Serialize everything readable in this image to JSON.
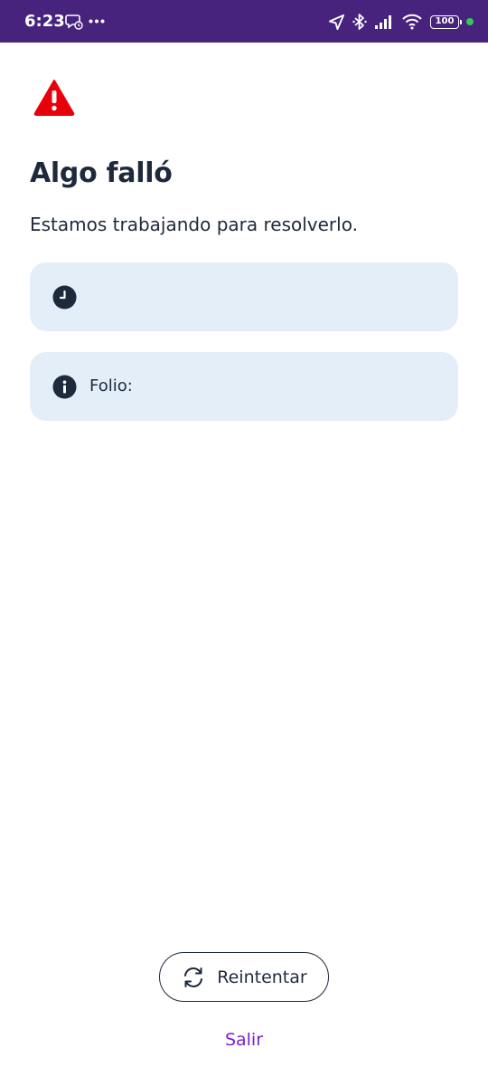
{
  "status_bar": {
    "time": "6:23",
    "battery": "100",
    "icons": [
      "chat-bubble-icon",
      "more-dots-icon",
      "navigation-arrow-icon",
      "bluetooth-icon",
      "signal-bars-icon",
      "wifi-icon",
      "battery-icon",
      "online-dot"
    ],
    "background_color": "#47237e"
  },
  "error": {
    "icon": "warning-triangle-icon",
    "icon_color": "#e8000b",
    "title": "Algo falló",
    "message": "Estamos trabajando para resolverlo."
  },
  "cards": [
    {
      "icon": "clock-icon",
      "text": ""
    },
    {
      "icon": "info-icon",
      "text": "Folio:"
    }
  ],
  "card_background": "#e3eef9",
  "actions": {
    "retry_label": "Reintentar",
    "retry_icon": "refresh-icon",
    "exit_label": "Salir",
    "exit_color": "#7b1fd1"
  }
}
